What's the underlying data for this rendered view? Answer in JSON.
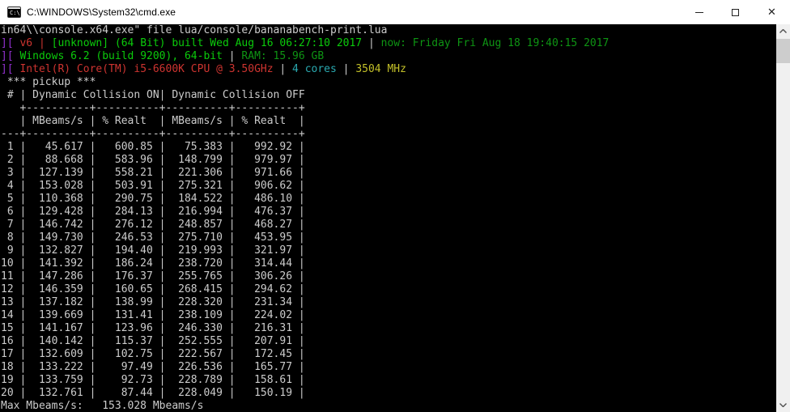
{
  "window": {
    "title": "C:\\WINDOWS\\System32\\cmd.exe",
    "icon_text": "C:\\_",
    "controls": {
      "minimize": "minimize",
      "maximize": "maximize",
      "close": "close"
    }
  },
  "colors": {
    "d": "#cccccc",
    "r": "#ce3430",
    "m": "#9130ce",
    "g": "#0bcb0b",
    "G": "#0e9413",
    "c": "#2aa9b0",
    "y": "#c3c029"
  },
  "console": {
    "lines": [
      [
        [
          "in64\\\\console.x64.exe\" file lua/console/bananabench-print.lua",
          "d"
        ]
      ],
      [
        [
          "][",
          "m"
        ],
        [
          " v6 | ",
          "r"
        ],
        [
          "[unknown] (64 Bit) built Wed Aug 16 06:27:10 2017",
          "g"
        ],
        [
          " | ",
          "d"
        ],
        [
          "now: Friday Fri Aug 18 19:40:15 2017",
          "G"
        ]
      ],
      [
        [
          "][",
          "m"
        ],
        [
          " Windows 6.2 (build 9200), 64-bit",
          "g"
        ],
        [
          " | ",
          "d"
        ],
        [
          "RAM: 15.96 GB",
          "G"
        ]
      ],
      [
        [
          "][",
          "m"
        ],
        [
          " Intel(R) Core(TM) i5-6600K CPU @ 3.50GHz",
          "r"
        ],
        [
          " | ",
          "d"
        ],
        [
          "4 cores",
          "c"
        ],
        [
          " | ",
          "d"
        ],
        [
          "3504 MHz",
          "y"
        ]
      ],
      [
        [
          " *** pickup ***",
          "d"
        ]
      ],
      [
        [
          " # | Dynamic Collision ON| Dynamic Collision OFF",
          "d"
        ]
      ],
      [
        [
          "   +----------+----------+----------+----------+",
          "d"
        ]
      ],
      [
        [
          "   | MBeams/s | % Realt  | MBeams/s | % Realt  |",
          "d"
        ]
      ],
      [
        [
          "---+----------+----------+----------+----------+",
          "d"
        ]
      ]
    ],
    "table": {
      "group_headers": [
        "Dynamic Collision ON",
        "Dynamic Collision OFF"
      ],
      "columns": [
        "#",
        "MBeams/s",
        "% Realt",
        "MBeams/s",
        "% Realt"
      ],
      "rows": [
        [
          "1",
          "45.617",
          "600.85",
          "75.383",
          "992.92"
        ],
        [
          "2",
          "88.668",
          "583.96",
          "148.799",
          "979.97"
        ],
        [
          "3",
          "127.139",
          "558.21",
          "221.306",
          "971.66"
        ],
        [
          "4",
          "153.028",
          "503.91",
          "275.321",
          "906.62"
        ],
        [
          "5",
          "110.368",
          "290.75",
          "184.522",
          "486.10"
        ],
        [
          "6",
          "129.428",
          "284.13",
          "216.994",
          "476.37"
        ],
        [
          "7",
          "146.742",
          "276.12",
          "248.857",
          "468.27"
        ],
        [
          "8",
          "149.730",
          "246.53",
          "275.710",
          "453.95"
        ],
        [
          "9",
          "132.827",
          "194.40",
          "219.993",
          "321.97"
        ],
        [
          "10",
          "141.392",
          "186.24",
          "238.720",
          "314.44"
        ],
        [
          "11",
          "147.286",
          "176.37",
          "255.765",
          "306.26"
        ],
        [
          "12",
          "146.359",
          "160.65",
          "268.415",
          "294.62"
        ],
        [
          "13",
          "137.182",
          "138.99",
          "228.320",
          "231.34"
        ],
        [
          "14",
          "139.669",
          "131.41",
          "238.109",
          "224.02"
        ],
        [
          "15",
          "141.167",
          "123.96",
          "246.330",
          "216.31"
        ],
        [
          "16",
          "140.142",
          "115.37",
          "252.555",
          "207.91"
        ],
        [
          "17",
          "132.609",
          "102.75",
          "222.567",
          "172.45"
        ],
        [
          "18",
          "133.222",
          "97.49",
          "226.536",
          "165.77"
        ],
        [
          "19",
          "133.759",
          "92.73",
          "228.789",
          "158.61"
        ],
        [
          "20",
          "132.761",
          "87.44",
          "228.049",
          "150.19"
        ]
      ]
    },
    "footer": "Max Mbeams/s:   153.028 Mbeams/s"
  }
}
